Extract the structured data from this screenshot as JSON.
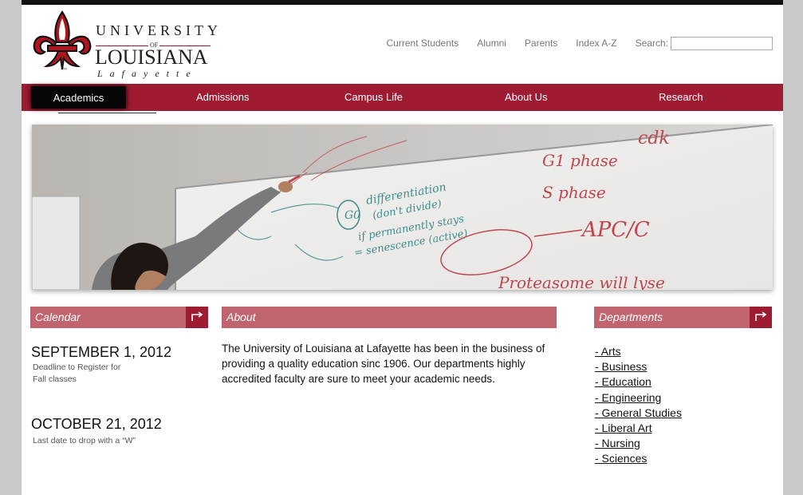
{
  "logo": {
    "line1": "UNIVERSITY",
    "line2": "OF",
    "line3": "LOUISIANA",
    "line4": "Lafayette",
    "tm": "™"
  },
  "utility": {
    "links": [
      "Current Students",
      "Alumni",
      "Parents",
      "Index A-Z"
    ],
    "search_label": "Search:",
    "search_value": ""
  },
  "nav": {
    "items": [
      "Academics",
      "Admissions",
      "Campus Life",
      "About Us",
      "Research"
    ],
    "active": "Academics"
  },
  "hero": {
    "board_text": [
      "G1 phase",
      "S phase",
      "cdk",
      "APC/C",
      "differentiation",
      "(don't divide)",
      "if permanently stays",
      "= senescence (active)",
      "Proteasome will lyse",
      "G0"
    ]
  },
  "calendar": {
    "title": "Calendar",
    "events": [
      {
        "date": "SEPTEMBER 1, 2012",
        "desc": [
          "Deadline to Register for",
          "Fall classes"
        ]
      },
      {
        "date": "OCTOBER 21, 2012",
        "desc": [
          "Last date to drop with a “W”"
        ]
      }
    ]
  },
  "about": {
    "title": "About",
    "text": "The University of Louisiana at Lafayette has been in the business of providing a quality education sinc 1906. Our departments highly accredited faculty are sure to meet your academic needs."
  },
  "departments": {
    "title": "Departments",
    "items": [
      "- Arts",
      "- Business",
      "- Education",
      "- Engineering",
      "- General Studies",
      "- Liberal Art",
      "- Nursing",
      "- Sciences"
    ]
  },
  "colors": {
    "brand_red": "#9e1b32",
    "header_pink": "#c06570",
    "active_nav": "#050505"
  }
}
